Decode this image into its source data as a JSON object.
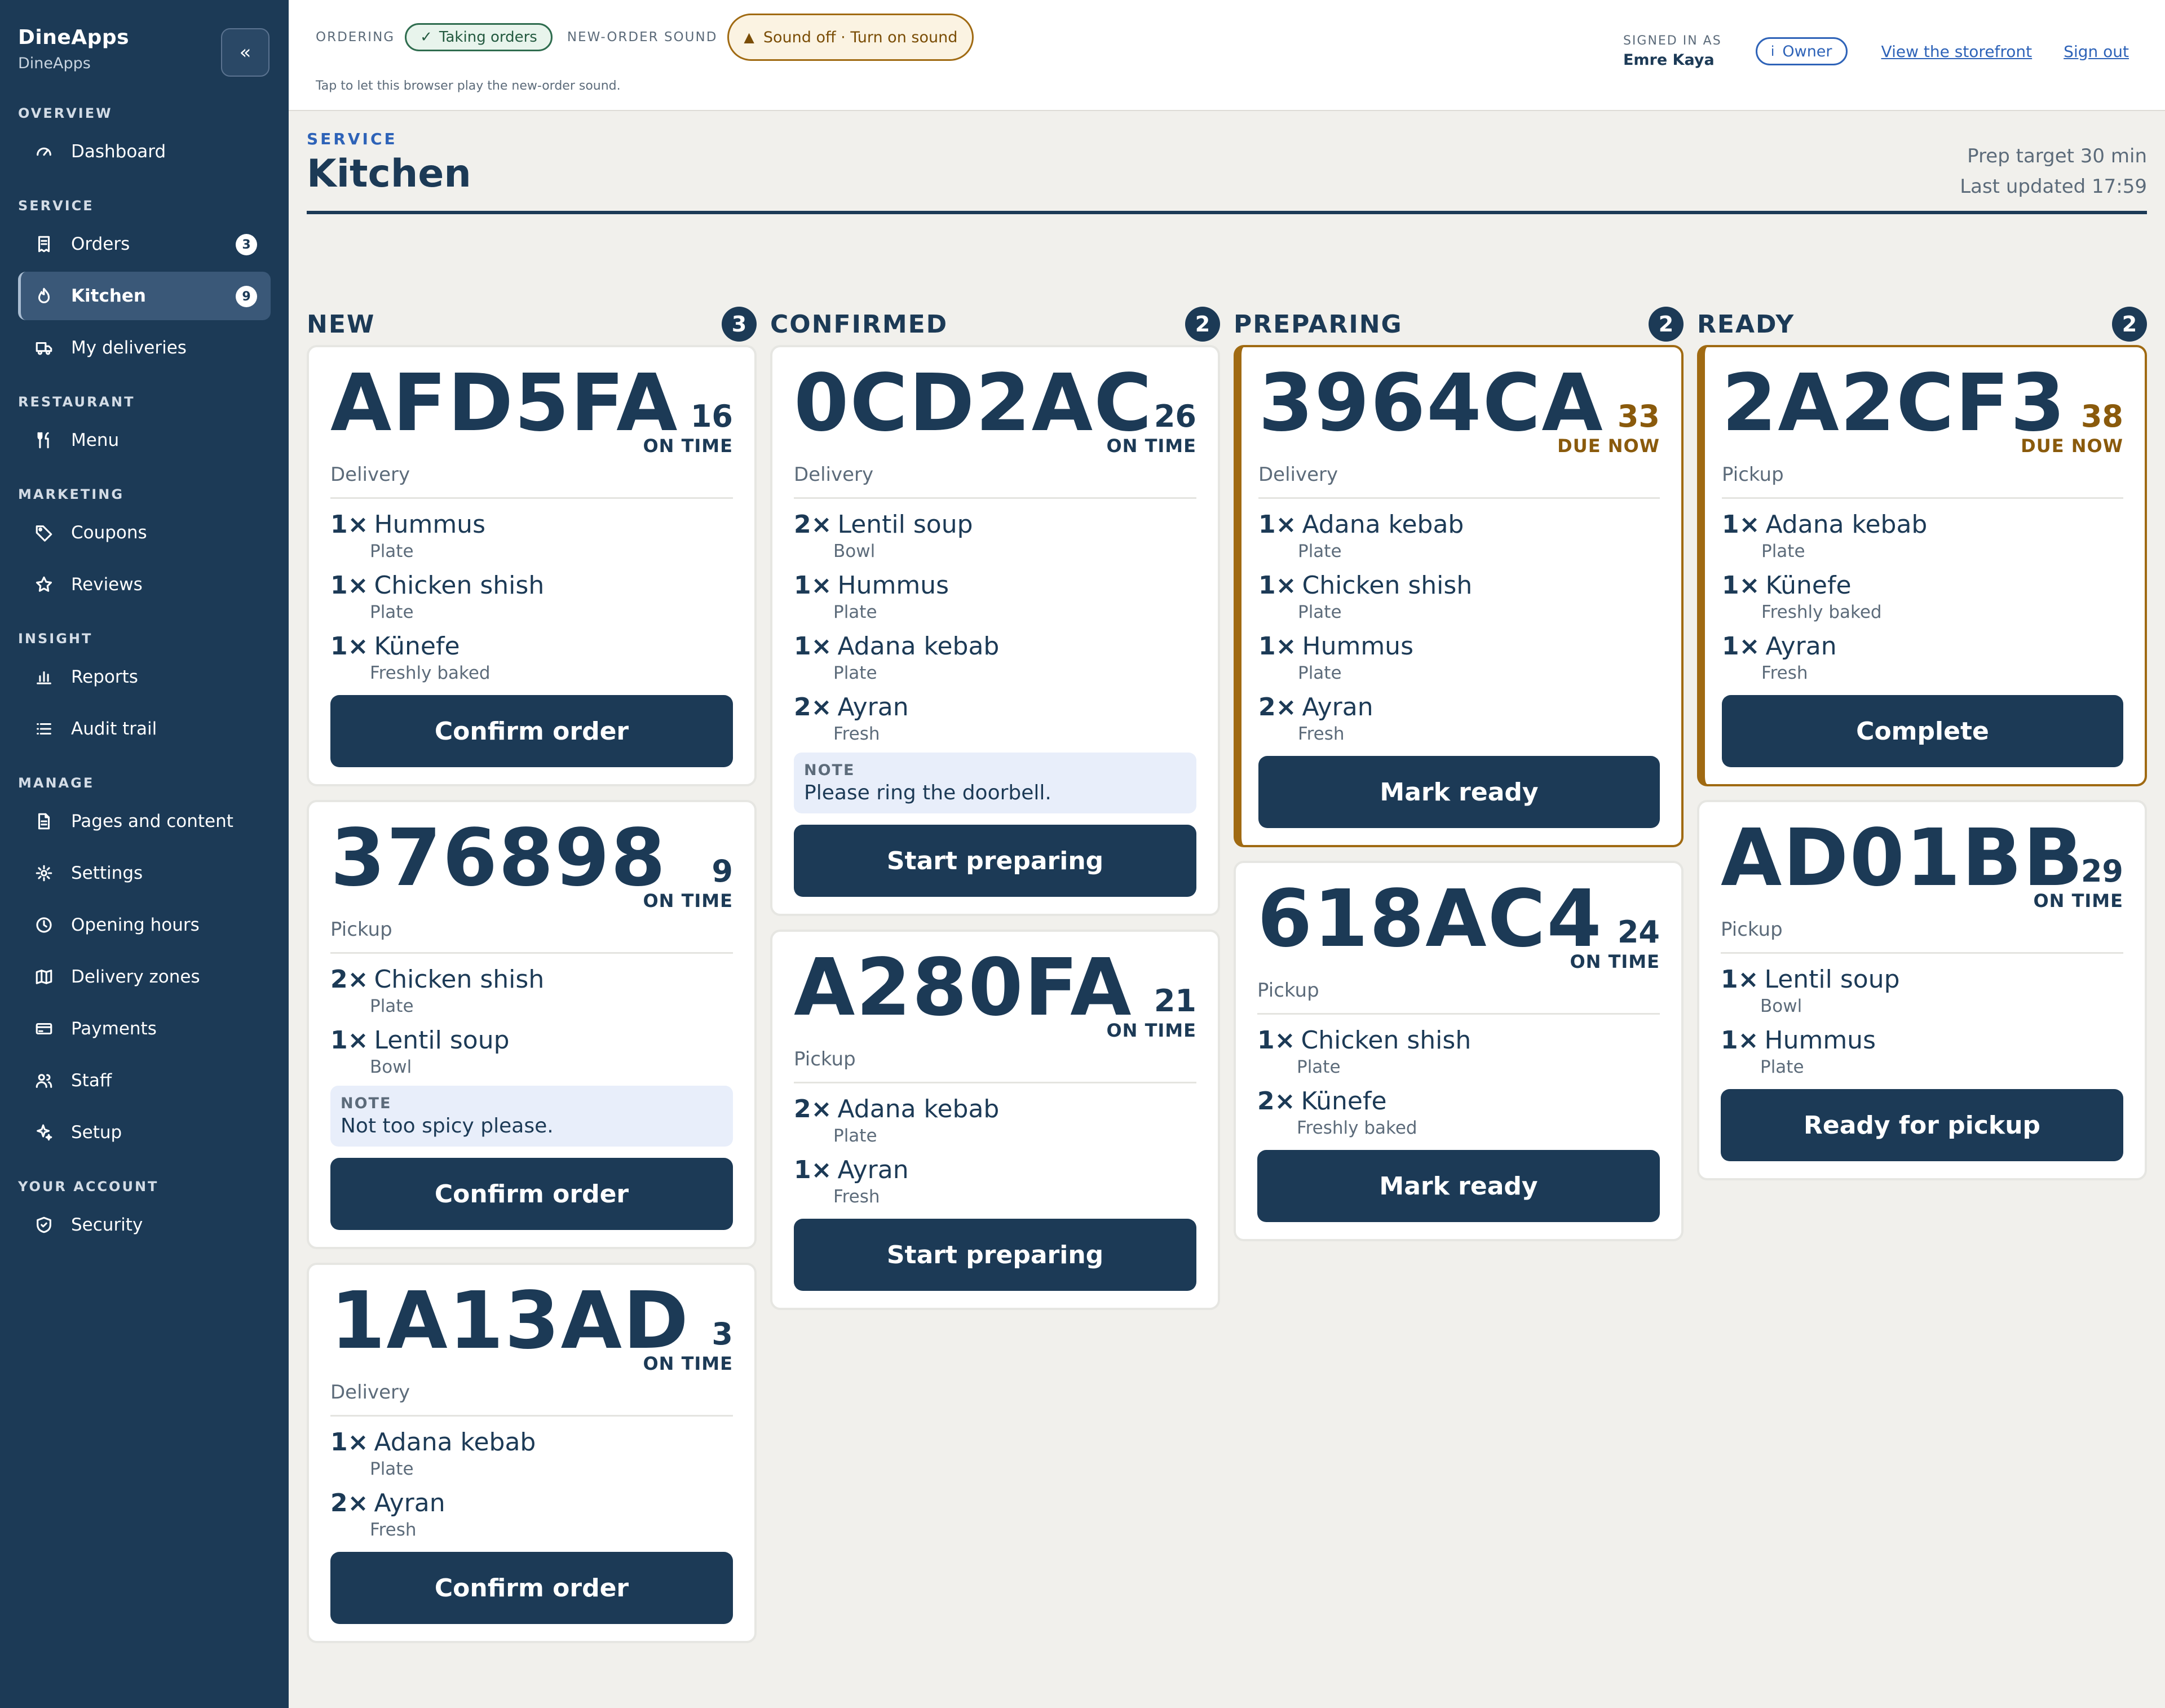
{
  "sidebar": {
    "brand": "DineApps",
    "sub": "DineApps",
    "collapse": "«",
    "sections": [
      {
        "title": "OVERVIEW",
        "items": [
          {
            "label": "Dashboard",
            "icon": "gauge-icon"
          }
        ]
      },
      {
        "title": "SERVICE",
        "items": [
          {
            "label": "Orders",
            "icon": "receipt-icon",
            "badge": "3"
          },
          {
            "label": "Kitchen",
            "icon": "flame-icon",
            "badge": "9",
            "active": true
          },
          {
            "label": "My deliveries",
            "icon": "truck-icon"
          }
        ]
      },
      {
        "title": "RESTAURANT",
        "items": [
          {
            "label": "Menu",
            "icon": "utensils-icon"
          }
        ]
      },
      {
        "title": "MARKETING",
        "items": [
          {
            "label": "Coupons",
            "icon": "tag-icon"
          },
          {
            "label": "Reviews",
            "icon": "star-icon"
          }
        ]
      },
      {
        "title": "INSIGHT",
        "items": [
          {
            "label": "Reports",
            "icon": "bar-chart-icon"
          },
          {
            "label": "Audit trail",
            "icon": "list-icon"
          }
        ]
      },
      {
        "title": "MANAGE",
        "items": [
          {
            "label": "Pages and content",
            "icon": "file-icon"
          },
          {
            "label": "Settings",
            "icon": "gear-icon"
          },
          {
            "label": "Opening hours",
            "icon": "clock-icon"
          },
          {
            "label": "Delivery zones",
            "icon": "map-icon"
          },
          {
            "label": "Payments",
            "icon": "card-icon"
          },
          {
            "label": "Staff",
            "icon": "users-icon"
          },
          {
            "label": "Setup",
            "icon": "sparkle-icon"
          }
        ]
      },
      {
        "title": "YOUR ACCOUNT",
        "items": [
          {
            "label": "Security",
            "icon": "shield-icon"
          }
        ]
      }
    ]
  },
  "topbar": {
    "ordering_label": "ORDERING",
    "ordering_status": "Taking orders",
    "sound_label": "NEW-ORDER SOUND",
    "sound_status": "Sound off · Turn on sound",
    "hint": "Tap to let this browser play the new-order sound.",
    "signed_label": "SIGNED IN AS",
    "user_name": "Emre Kaya",
    "role": "Owner",
    "storefront": "View the storefront",
    "signout": "Sign out"
  },
  "header": {
    "eyebrow": "SERVICE",
    "title": "Kitchen",
    "prep_target": "Prep target 30 min",
    "last_updated": "Last updated 17:59"
  },
  "colors": {
    "navy": "#1c3a56",
    "due": "#a06a12",
    "link": "#2e63b8",
    "ok": "#2f6d4f"
  },
  "columns": [
    {
      "title": "NEW",
      "count": "3",
      "cards": [
        {
          "code": "AFD5FA",
          "age": "16",
          "status": "ON TIME",
          "due": false,
          "type": "Delivery",
          "items": [
            {
              "qty": "1×",
              "name": "Hummus",
              "sub": "Plate"
            },
            {
              "qty": "1×",
              "name": "Chicken shish",
              "sub": "Plate"
            },
            {
              "qty": "1×",
              "name": "Künefe",
              "sub": "Freshly baked"
            }
          ],
          "note": null,
          "action": "Confirm order"
        },
        {
          "code": "376898",
          "age": "9",
          "status": "ON TIME",
          "due": false,
          "type": "Pickup",
          "items": [
            {
              "qty": "2×",
              "name": "Chicken shish",
              "sub": "Plate"
            },
            {
              "qty": "1×",
              "name": "Lentil soup",
              "sub": "Bowl"
            }
          ],
          "note": {
            "label": "NOTE",
            "text": "Not too spicy please."
          },
          "action": "Confirm order"
        },
        {
          "code": "1A13AD",
          "age": "3",
          "status": "ON TIME",
          "due": false,
          "type": "Delivery",
          "items": [
            {
              "qty": "1×",
              "name": "Adana kebab",
              "sub": "Plate"
            },
            {
              "qty": "2×",
              "name": "Ayran",
              "sub": "Fresh"
            }
          ],
          "note": null,
          "action": "Confirm order"
        }
      ]
    },
    {
      "title": "CONFIRMED",
      "count": "2",
      "cards": [
        {
          "code": "0CD2AC",
          "age": "26",
          "status": "ON TIME",
          "due": false,
          "type": "Delivery",
          "items": [
            {
              "qty": "2×",
              "name": "Lentil soup",
              "sub": "Bowl"
            },
            {
              "qty": "1×",
              "name": "Hummus",
              "sub": "Plate"
            },
            {
              "qty": "1×",
              "name": "Adana kebab",
              "sub": "Plate"
            },
            {
              "qty": "2×",
              "name": "Ayran",
              "sub": "Fresh"
            }
          ],
          "note": {
            "label": "NOTE",
            "text": "Please ring the doorbell."
          },
          "action": "Start preparing"
        },
        {
          "code": "A280FA",
          "age": "21",
          "status": "ON TIME",
          "due": false,
          "type": "Pickup",
          "items": [
            {
              "qty": "2×",
              "name": "Adana kebab",
              "sub": "Plate"
            },
            {
              "qty": "1×",
              "name": "Ayran",
              "sub": "Fresh"
            }
          ],
          "note": null,
          "action": "Start preparing"
        }
      ]
    },
    {
      "title": "PREPARING",
      "count": "2",
      "cards": [
        {
          "code": "3964CA",
          "age": "33",
          "status": "DUE NOW",
          "due": true,
          "type": "Delivery",
          "items": [
            {
              "qty": "1×",
              "name": "Adana kebab",
              "sub": "Plate"
            },
            {
              "qty": "1×",
              "name": "Chicken shish",
              "sub": "Plate"
            },
            {
              "qty": "1×",
              "name": "Hummus",
              "sub": "Plate"
            },
            {
              "qty": "2×",
              "name": "Ayran",
              "sub": "Fresh"
            }
          ],
          "note": null,
          "action": "Mark ready"
        },
        {
          "code": "618AC4",
          "age": "24",
          "status": "ON TIME",
          "due": false,
          "type": "Pickup",
          "items": [
            {
              "qty": "1×",
              "name": "Chicken shish",
              "sub": "Plate"
            },
            {
              "qty": "2×",
              "name": "Künefe",
              "sub": "Freshly baked"
            }
          ],
          "note": null,
          "action": "Mark ready"
        }
      ]
    },
    {
      "title": "READY",
      "count": "2",
      "cards": [
        {
          "code": "2A2CF3",
          "age": "38",
          "status": "DUE NOW",
          "due": true,
          "type": "Pickup",
          "items": [
            {
              "qty": "1×",
              "name": "Adana kebab",
              "sub": "Plate"
            },
            {
              "qty": "1×",
              "name": "Künefe",
              "sub": "Freshly baked"
            },
            {
              "qty": "1×",
              "name": "Ayran",
              "sub": "Fresh"
            }
          ],
          "note": null,
          "action": "Complete"
        },
        {
          "code": "AD01BB",
          "age": "29",
          "status": "ON TIME",
          "due": false,
          "type": "Pickup",
          "items": [
            {
              "qty": "1×",
              "name": "Lentil soup",
              "sub": "Bowl"
            },
            {
              "qty": "1×",
              "name": "Hummus",
              "sub": "Plate"
            }
          ],
          "note": null,
          "action": "Ready for pickup"
        }
      ]
    }
  ]
}
